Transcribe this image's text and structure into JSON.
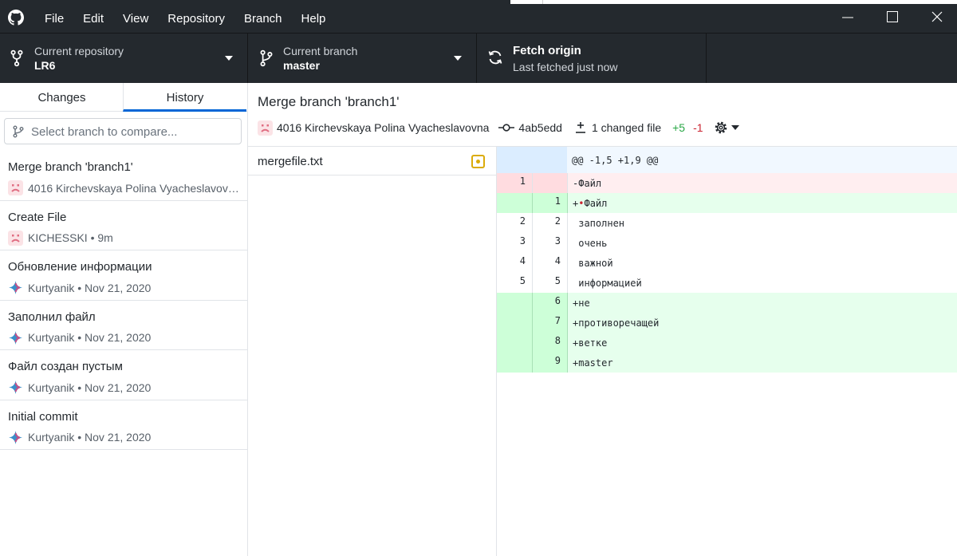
{
  "menu": {
    "items": [
      "File",
      "Edit",
      "View",
      "Repository",
      "Branch",
      "Help"
    ]
  },
  "toolbar": {
    "repo_title": "Current repository",
    "repo_value": "LR6",
    "branch_title": "Current branch",
    "branch_value": "master",
    "fetch_title": "Fetch origin",
    "fetch_sub": "Last fetched just now"
  },
  "sidebar": {
    "tabs": [
      "Changes",
      "History"
    ],
    "active_tab": "History",
    "compare_placeholder": "Select branch to compare...",
    "commits": [
      {
        "title": "Merge branch 'branch1'",
        "meta": "4016 Kirchevskaya Polina Vyacheslavovn…",
        "avatar": "sad-face-avatar"
      },
      {
        "title": "Create File",
        "meta": "KICHESSKI • 9m",
        "avatar": "sad-face-avatar"
      },
      {
        "title": "Обновление информации",
        "meta": "Kurtyanik • Nov 21, 2020",
        "avatar": "star-avatar"
      },
      {
        "title": "Заполнил файл",
        "meta": "Kurtyanik • Nov 21, 2020",
        "avatar": "star-avatar"
      },
      {
        "title": "Файл создан пустым",
        "meta": "Kurtyanik • Nov 21, 2020",
        "avatar": "star-avatar"
      },
      {
        "title": "Initial commit",
        "meta": "Kurtyanik • Nov 21, 2020",
        "avatar": "star-avatar"
      }
    ]
  },
  "commit_detail": {
    "title": "Merge branch 'branch1'",
    "author": "4016 Kirchevskaya Polina Vyacheslavovna",
    "sha": "4ab5edd",
    "changed_files": "1 changed file",
    "additions": "+5",
    "deletions": "-1"
  },
  "files": [
    {
      "name": "mergefile.txt",
      "status": "modified"
    }
  ],
  "diff": {
    "hunk_header": "@@ -1,5 +1,9 @@",
    "lines": [
      {
        "type": "del",
        "old": "1",
        "new": "",
        "text": "-Файл"
      },
      {
        "type": "add",
        "old": "",
        "new": "1",
        "prefix": "+",
        "ws": "•",
        "text": "Файл"
      },
      {
        "type": "ctx",
        "old": "2",
        "new": "2",
        "text": " заполнен"
      },
      {
        "type": "ctx",
        "old": "3",
        "new": "3",
        "text": " очень"
      },
      {
        "type": "ctx",
        "old": "4",
        "new": "4",
        "text": " важной"
      },
      {
        "type": "ctx",
        "old": "5",
        "new": "5",
        "text": " информацией"
      },
      {
        "type": "add",
        "old": "",
        "new": "6",
        "text": "+не"
      },
      {
        "type": "add",
        "old": "",
        "new": "7",
        "text": "+противоречащей"
      },
      {
        "type": "add",
        "old": "",
        "new": "8",
        "text": "+ветке"
      },
      {
        "type": "add",
        "old": "",
        "new": "9",
        "text": "+master"
      }
    ]
  },
  "colors": {
    "chrome_dark": "#24292e",
    "accent_blue": "#0366d6",
    "add_green": "#28a745",
    "del_red": "#cb2431",
    "modified_yellow": "#dbab09"
  }
}
